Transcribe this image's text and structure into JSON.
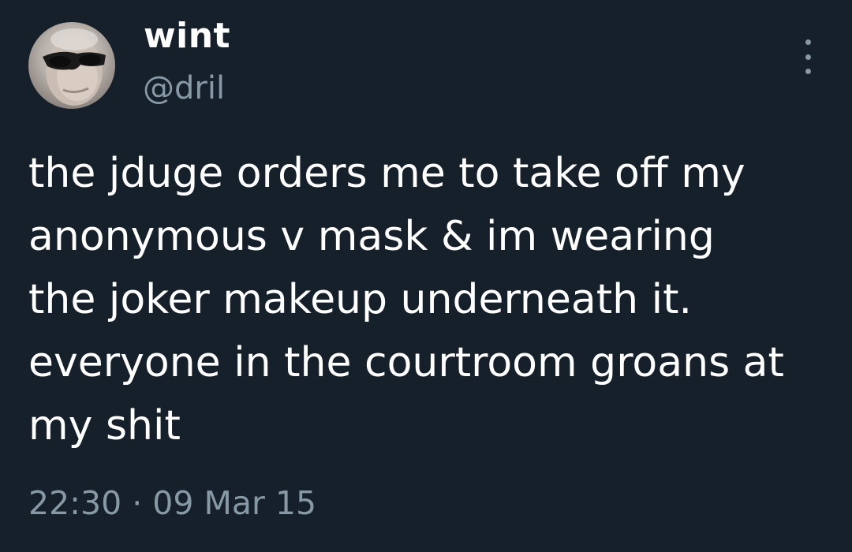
{
  "author": {
    "display_name": "wint",
    "handle": "@dril"
  },
  "tweet": {
    "lines": [
      "the jduge orders me to take off my",
      "anonymous v mask & im wearing",
      "the joker makeup underneath it.",
      "everyone in the courtroom groans at",
      "my shit"
    ],
    "time": "22:30",
    "separator": "·",
    "date": "09 Mar 15"
  },
  "icons": {
    "more": "more-vertical-icon",
    "avatar": "profile-avatar"
  },
  "colors": {
    "background": "#15202b",
    "text": "#ffffff",
    "secondary_text": "#8899a6"
  }
}
